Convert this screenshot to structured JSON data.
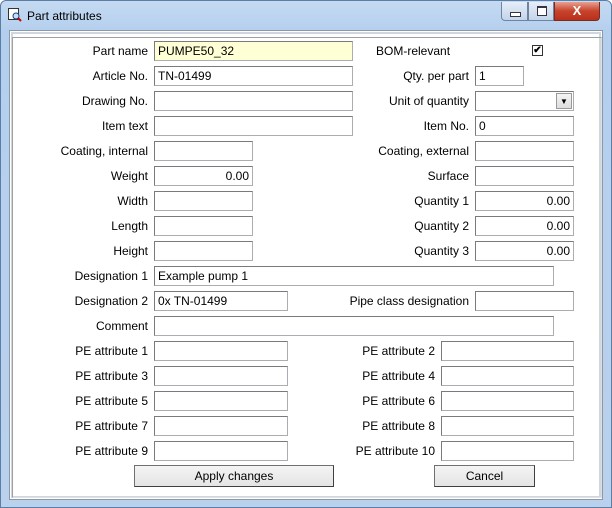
{
  "window": {
    "title": "Part attributes",
    "close_glyph": "X"
  },
  "fields": {
    "part_name": {
      "label": "Part name",
      "value": "PUMPE50_32"
    },
    "article_no": {
      "label": "Article No.",
      "value": "TN-01499"
    },
    "drawing_no": {
      "label": "Drawing No.",
      "value": ""
    },
    "item_text": {
      "label": "Item text",
      "value": ""
    },
    "coating_internal": {
      "label": "Coating, internal",
      "value": ""
    },
    "weight": {
      "label": "Weight",
      "value": "0.00"
    },
    "width": {
      "label": "Width",
      "value": ""
    },
    "length": {
      "label": "Length",
      "value": ""
    },
    "height": {
      "label": "Height",
      "value": ""
    },
    "designation_1": {
      "label": "Designation 1",
      "value": "Example pump 1"
    },
    "designation_2": {
      "label": "Designation 2",
      "value": "0x TN-01499"
    },
    "comment": {
      "label": "Comment",
      "value": ""
    },
    "bom_relevant": {
      "label": "BOM-relevant",
      "checked": true,
      "mark": "✔"
    },
    "qty_per_part": {
      "label": "Qty. per part",
      "value": "1"
    },
    "unit_of_quantity": {
      "label": "Unit of quantity",
      "value": "",
      "arrow": "▼"
    },
    "item_no": {
      "label": "Item No.",
      "value": "0"
    },
    "coating_external": {
      "label": "Coating, external",
      "value": ""
    },
    "surface": {
      "label": "Surface",
      "value": ""
    },
    "quantity_1": {
      "label": "Quantity 1",
      "value": "0.00"
    },
    "quantity_2": {
      "label": "Quantity 2",
      "value": "0.00"
    },
    "quantity_3": {
      "label": "Quantity 3",
      "value": "0.00"
    },
    "pipe_class_designation": {
      "label": "Pipe class designation",
      "value": ""
    },
    "pe_1": {
      "label": "PE attribute 1",
      "value": ""
    },
    "pe_2": {
      "label": "PE attribute 2",
      "value": ""
    },
    "pe_3": {
      "label": "PE attribute 3",
      "value": ""
    },
    "pe_4": {
      "label": "PE attribute 4",
      "value": ""
    },
    "pe_5": {
      "label": "PE attribute 5",
      "value": ""
    },
    "pe_6": {
      "label": "PE attribute 6",
      "value": ""
    },
    "pe_7": {
      "label": "PE attribute 7",
      "value": ""
    },
    "pe_8": {
      "label": "PE attribute 8",
      "value": ""
    },
    "pe_9": {
      "label": "PE attribute 9",
      "value": ""
    },
    "pe_10": {
      "label": "PE attribute 10",
      "value": ""
    }
  },
  "buttons": {
    "apply": "Apply changes",
    "cancel": "Cancel"
  }
}
